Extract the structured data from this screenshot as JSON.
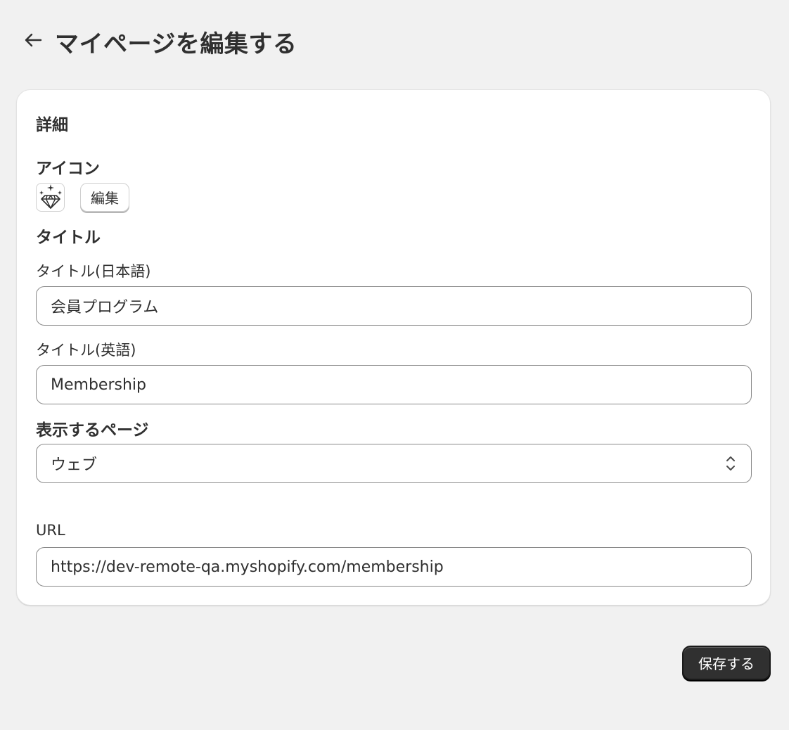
{
  "header": {
    "title": "マイページを編集する",
    "back_icon": "arrow-left-icon"
  },
  "details": {
    "section_title": "詳細",
    "icon": {
      "heading": "アイコン",
      "current_icon": "sparkling-diamond-icon",
      "edit_label": "編集"
    },
    "title": {
      "heading": "タイトル",
      "ja_label": "タイトル(日本語)",
      "ja_value": "会員プログラム",
      "en_label": "タイトル(英語)",
      "en_value": "Membership"
    },
    "display_page": {
      "heading": "表示するページ",
      "selected": "ウェブ",
      "chevron_icon": "select-chevron-updown-icon"
    },
    "url": {
      "label": "URL",
      "value": "https://dev-remote-qa.myshopify.com/membership"
    }
  },
  "footer": {
    "save_label": "保存する"
  },
  "colors": {
    "background": "#f1f1f1",
    "card": "#ffffff",
    "primary_button": "#303030",
    "text": "#303030"
  }
}
